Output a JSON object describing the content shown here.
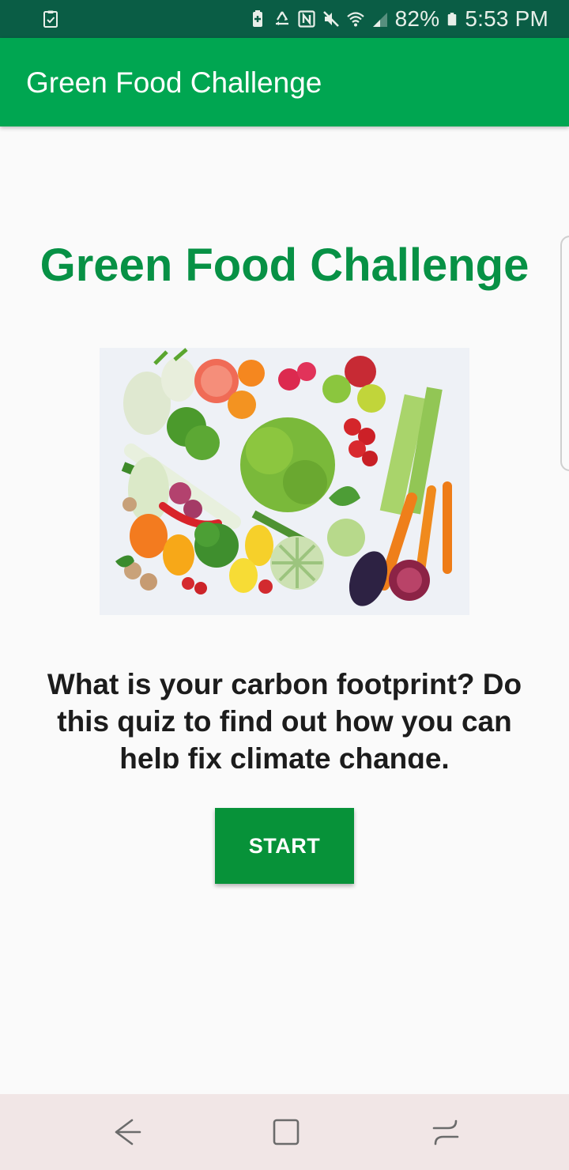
{
  "status_bar": {
    "battery_percent": "82%",
    "time": "5:53 PM",
    "icons": [
      "clipboard-check-icon",
      "battery-saver-icon",
      "recycle-icon",
      "nfc-icon",
      "mute-icon",
      "wifi-icon",
      "signal-icon",
      "battery-icon"
    ]
  },
  "app_bar": {
    "title": "Green Food Challenge"
  },
  "main": {
    "title": "Green Food Challenge",
    "image": "vegetables-photo",
    "description": "What is your carbon footprint? Do this quiz to find out how you can help fix climate change.",
    "start_label": "START"
  },
  "nav_bar": {
    "icons": [
      "back-icon",
      "home-icon",
      "recents-icon"
    ]
  },
  "colors": {
    "status_bar": "#0a5d45",
    "app_bar": "#00a651",
    "title_green": "#079145",
    "button_green": "#079239",
    "background": "#fafafa",
    "nav_bar": "#f1e6e6"
  }
}
